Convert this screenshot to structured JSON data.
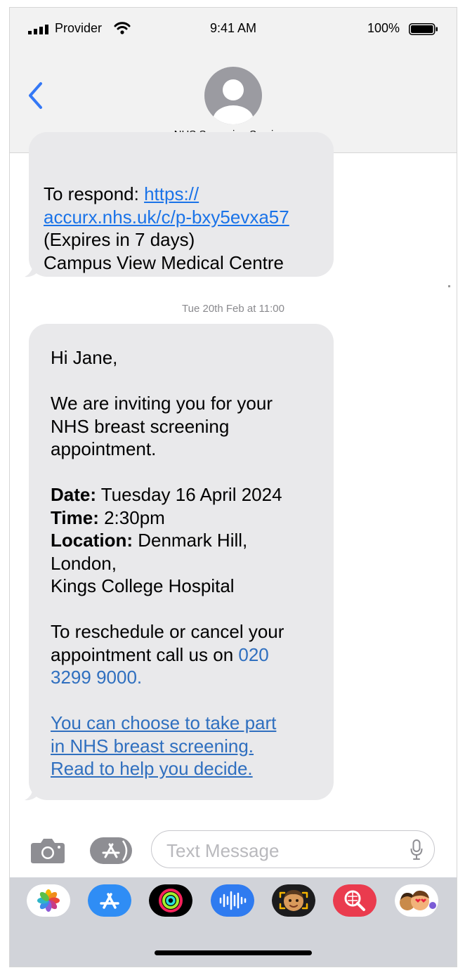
{
  "status_bar": {
    "provider": "Provider",
    "time": "9:41 AM",
    "battery": "100%"
  },
  "header": {
    "contact_name": "NHS Screening Service",
    "contact_chevron": ">"
  },
  "messages": {
    "first": {
      "respond_label": "To respond: ",
      "link_line1": "https://",
      "link_line2": "accurx.nhs.uk/c/p-bxy5evxa57",
      "expires": "(Expires in 7 days)",
      "sender": "Campus View Medical Centre"
    },
    "timestamp": "Tue 20th Feb at 11:00",
    "second": {
      "greeting": "Hi Jane,",
      "intro_line1": "We are inviting you for your",
      "intro_line2": "NHS breast screening",
      "intro_line3": "appointment.",
      "date_label": "Date:",
      "date_value": " Tuesday 16 April 2024",
      "time_label": "Time:",
      "time_value": " 2:30pm",
      "location_label": "Location:",
      "location_value": " Denmark Hill,",
      "location_line2": "London,",
      "location_line3": "Kings College Hospital",
      "reschedule_line1": "To reschedule or cancel your",
      "reschedule_line2": "appointment call us on ",
      "phone_part1": "020",
      "phone_part2": "3299 9000.",
      "choice_line1": "You can choose to take part",
      "choice_line2": "in NHS breast screening.",
      "choice_line3": "Read to help you decide."
    }
  },
  "input": {
    "placeholder": "Text Message"
  },
  "app_tray": {
    "apps": [
      "photos-app",
      "app-store-app",
      "activity-app",
      "audio-messages-app",
      "memoji-app",
      "search-images-app",
      "memoji-stickers-app"
    ]
  },
  "colors": {
    "link_blue": "#1a73e8",
    "bubble_gray": "#e9e9eb",
    "ios_blue": "#3478f6",
    "tray_gray": "#d1d3d9"
  }
}
